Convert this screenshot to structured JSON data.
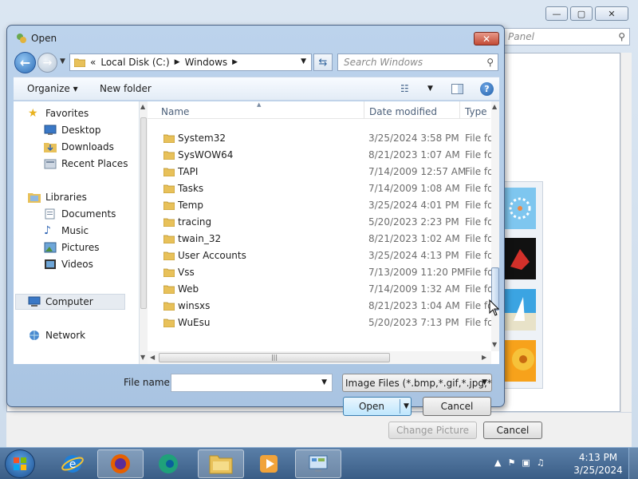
{
  "background_window": {
    "search_placeholder": "Panel",
    "change_picture_label": "Change Picture",
    "cancel_label": "Cancel",
    "title_buttons": {
      "minimize": "—",
      "maximize": "▢",
      "close": "✕"
    }
  },
  "dialog": {
    "title": "Open",
    "close_glyph": "✕",
    "address": {
      "overflow": "«",
      "crumbs": [
        "Local Disk (C:)",
        "Windows"
      ]
    },
    "search_placeholder": "Search Windows",
    "toolbar": {
      "organize": "Organize ▾",
      "new_folder": "New folder",
      "help": "?"
    },
    "nav": {
      "favorites": "Favorites",
      "desktop": "Desktop",
      "downloads": "Downloads",
      "recent_places": "Recent Places",
      "libraries": "Libraries",
      "documents": "Documents",
      "music": "Music",
      "pictures": "Pictures",
      "videos": "Videos",
      "computer": "Computer",
      "network": "Network"
    },
    "columns": {
      "name": "Name",
      "date": "Date modified",
      "type": "Type"
    },
    "files": [
      {
        "name": "System32",
        "date": "3/25/2024 3:58 PM",
        "type": "File fol"
      },
      {
        "name": "SysWOW64",
        "date": "8/21/2023 1:07 AM",
        "type": "File fol"
      },
      {
        "name": "TAPI",
        "date": "7/14/2009 12:57 AM",
        "type": "File fol"
      },
      {
        "name": "Tasks",
        "date": "7/14/2009 1:08 AM",
        "type": "File fol"
      },
      {
        "name": "Temp",
        "date": "3/25/2024 4:01 PM",
        "type": "File fol"
      },
      {
        "name": "tracing",
        "date": "5/20/2023 2:23 PM",
        "type": "File fol"
      },
      {
        "name": "twain_32",
        "date": "8/21/2023 1:02 AM",
        "type": "File fol"
      },
      {
        "name": "User Accounts",
        "date": "3/25/2024 4:13 PM",
        "type": "File fol"
      },
      {
        "name": "Vss",
        "date": "7/13/2009 11:20 PM",
        "type": "File fol"
      },
      {
        "name": "Web",
        "date": "7/14/2009 1:32 AM",
        "type": "File fol"
      },
      {
        "name": "winsxs",
        "date": "8/21/2023 1:04 AM",
        "type": "File fol"
      },
      {
        "name": "WuEsu",
        "date": "5/20/2023 7:13 PM",
        "type": "File fol"
      }
    ],
    "file_name_label": "File name:",
    "file_name_value": "",
    "filter": "Image Files (*.bmp,*.gif,*.jpg,*.",
    "open_label": "Open",
    "cancel_label": "Cancel"
  },
  "taskbar": {
    "time": "4:13 PM",
    "date": "3/25/2024",
    "apps": [
      "internet-explorer-icon",
      "firefox-icon",
      "edge-icon",
      "file-explorer-icon",
      "media-player-icon",
      "control-panel-icon"
    ]
  },
  "colors": {
    "dialog_frame": "#a9c4e2",
    "selection": "#e6ebf1",
    "taskbar": "#3a5d86",
    "folder": "#e8c15a"
  }
}
